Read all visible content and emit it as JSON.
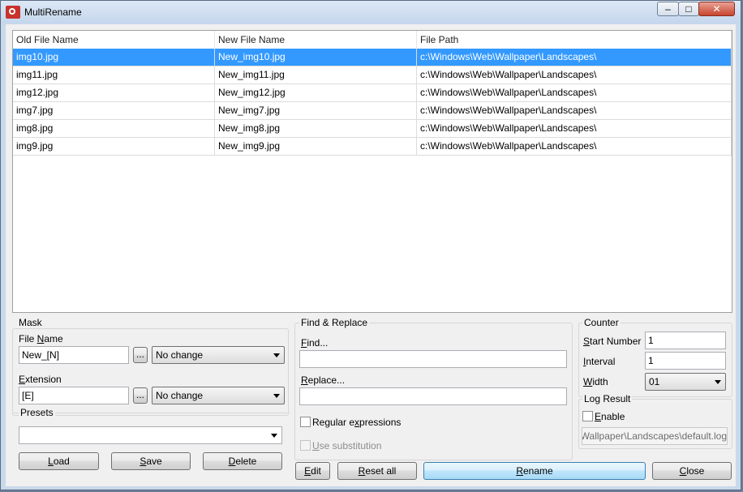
{
  "window": {
    "title": "MultiRename",
    "min_glyph": "–",
    "max_glyph": "□",
    "close_glyph": "✕"
  },
  "grid": {
    "columns": [
      "Old File Name",
      "New File Name",
      "File Path"
    ],
    "rows": [
      {
        "old": "img10.jpg",
        "new": "New_img10.jpg",
        "path": "c:\\Windows\\Web\\Wallpaper\\Landscapes\\"
      },
      {
        "old": "img11.jpg",
        "new": "New_img11.jpg",
        "path": "c:\\Windows\\Web\\Wallpaper\\Landscapes\\"
      },
      {
        "old": "img12.jpg",
        "new": "New_img12.jpg",
        "path": "c:\\Windows\\Web\\Wallpaper\\Landscapes\\"
      },
      {
        "old": "img7.jpg",
        "new": "New_img7.jpg",
        "path": "c:\\Windows\\Web\\Wallpaper\\Landscapes\\"
      },
      {
        "old": "img8.jpg",
        "new": "New_img8.jpg",
        "path": "c:\\Windows\\Web\\Wallpaper\\Landscapes\\"
      },
      {
        "old": "img9.jpg",
        "new": "New_img9.jpg",
        "path": "c:\\Windows\\Web\\Wallpaper\\Landscapes\\"
      }
    ]
  },
  "mask": {
    "title": "Mask",
    "file_name_label_pre": "File ",
    "file_name_label_u": "N",
    "file_name_label_post": "ame",
    "file_name_value": "New_[N]",
    "ellipsis": "...",
    "file_name_case": "No change",
    "extension_label_u": "E",
    "extension_label_post": "xtension",
    "extension_value": "[E]",
    "extension_case": "No change"
  },
  "presets": {
    "title": "Presets",
    "selected": "",
    "load_u": "L",
    "load_rest": "oad",
    "save_u": "S",
    "save_rest": "ave",
    "delete_u": "D",
    "delete_rest": "elete"
  },
  "find_replace": {
    "title": "Find & Replace",
    "find_u": "F",
    "find_rest": "ind...",
    "find_value": "",
    "replace_u": "R",
    "replace_rest": "eplace...",
    "replace_value": "",
    "regex_pre": "Regular e",
    "regex_u": "x",
    "regex_post": "pressions",
    "subst_u": "U",
    "subst_rest": "se substitution"
  },
  "counter": {
    "title": "Counter",
    "start_u": "S",
    "start_rest": "tart Number",
    "start_value": "1",
    "interval_u": "I",
    "interval_rest": "nterval",
    "interval_value": "1",
    "width_u": "W",
    "width_rest": "idth",
    "width_value": "01"
  },
  "log": {
    "title": "Log Result",
    "enable_u": "E",
    "enable_rest": "nable",
    "path_value": "Wallpaper\\Landscapes\\default.log"
  },
  "actions": {
    "edit_u": "E",
    "edit_rest": "dit",
    "reset_u": "R",
    "reset_rest": "eset all",
    "rename_u": "R",
    "rename_rest": "ename",
    "close_u": "C",
    "close_rest": "lose"
  }
}
